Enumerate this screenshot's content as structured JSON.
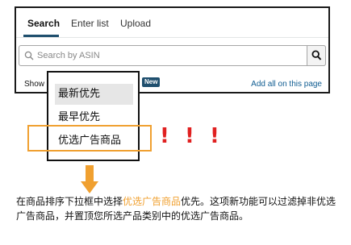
{
  "tabs": [
    {
      "label": "Search",
      "active": true
    },
    {
      "label": "Enter list",
      "active": false
    },
    {
      "label": "Upload",
      "active": false
    }
  ],
  "search": {
    "placeholder": "Search by ASIN",
    "value": ""
  },
  "toolbar": {
    "show_label": "Show",
    "new_badge": "New",
    "add_all_label": "Add all on this page"
  },
  "dropdown": {
    "options": [
      {
        "label": "最新优先",
        "highlighted": true
      },
      {
        "label": "最早优先",
        "highlighted": false
      },
      {
        "label": "优选广告商品",
        "highlighted": false
      }
    ]
  },
  "annotation": {
    "exclamations": [
      "!",
      "!",
      "!"
    ],
    "caption_before": "在商品排序下拉框中选择",
    "caption_accent": "优选广告商品",
    "caption_after": "优先。这项新功能可以过滤掉非优选广告商品，并置顶您所选产品类别中的优选广告商品。"
  },
  "colors": {
    "accent_orange": "#f0a030",
    "alert_red": "#e02020",
    "tab_underline": "#1f4f6e",
    "link_blue": "#0f5c91"
  }
}
